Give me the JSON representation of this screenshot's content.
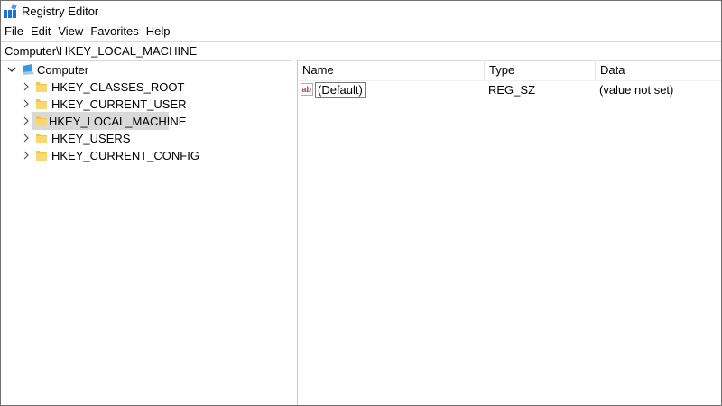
{
  "window": {
    "title": "Registry Editor",
    "app_icon": "registry-editor-icon"
  },
  "menu": {
    "items": [
      "File",
      "Edit",
      "View",
      "Favorites",
      "Help"
    ]
  },
  "address": {
    "path": "Computer\\HKEY_LOCAL_MACHINE"
  },
  "tree": {
    "root": {
      "label": "Computer",
      "icon": "computer-icon",
      "expanded": true
    },
    "items": [
      {
        "label": "HKEY_CLASSES_ROOT",
        "icon": "folder-icon",
        "selected": false
      },
      {
        "label": "HKEY_CURRENT_USER",
        "icon": "folder-icon",
        "selected": false
      },
      {
        "label": "HKEY_LOCAL_MACHINE",
        "icon": "folder-icon",
        "selected": true
      },
      {
        "label": "HKEY_USERS",
        "icon": "folder-icon",
        "selected": false
      },
      {
        "label": "HKEY_CURRENT_CONFIG",
        "icon": "folder-icon",
        "selected": false
      }
    ]
  },
  "list": {
    "columns": {
      "name": "Name",
      "type": "Type",
      "data": "Data"
    },
    "rows": [
      {
        "name": "(Default)",
        "type": "REG_SZ",
        "data": "(value not set)",
        "icon": "string-value-icon"
      }
    ]
  },
  "colors": {
    "selection": "#d9d9d9",
    "folder": "#f4c542",
    "string_icon": "#c0392b"
  }
}
